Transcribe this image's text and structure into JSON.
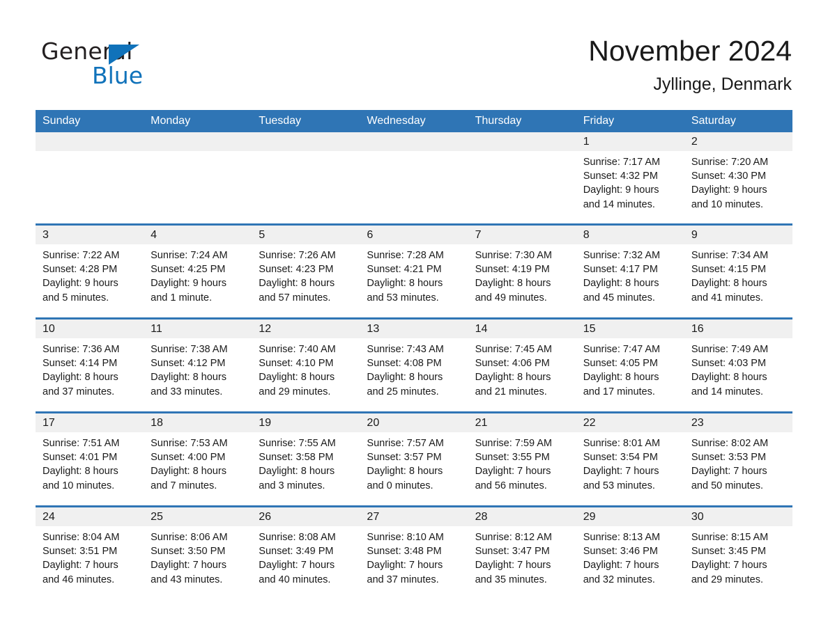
{
  "brand": {
    "name_part1": "General",
    "name_part2": "Blue",
    "accent_color": "#1072ba",
    "triangle_icon": "triangle-icon"
  },
  "header": {
    "title": "November 2024",
    "location": "Jyllinge, Denmark"
  },
  "theme": {
    "header_blue": "#2f75b5",
    "daynum_band": "#f0f0f0",
    "text": "#1a1a1a"
  },
  "weekdays": [
    "Sunday",
    "Monday",
    "Tuesday",
    "Wednesday",
    "Thursday",
    "Friday",
    "Saturday"
  ],
  "weeks": [
    [
      {
        "day": "",
        "lines": []
      },
      {
        "day": "",
        "lines": []
      },
      {
        "day": "",
        "lines": []
      },
      {
        "day": "",
        "lines": []
      },
      {
        "day": "",
        "lines": []
      },
      {
        "day": "1",
        "lines": [
          "Sunrise: 7:17 AM",
          "Sunset: 4:32 PM",
          "Daylight: 9 hours",
          "and 14 minutes."
        ]
      },
      {
        "day": "2",
        "lines": [
          "Sunrise: 7:20 AM",
          "Sunset: 4:30 PM",
          "Daylight: 9 hours",
          "and 10 minutes."
        ]
      }
    ],
    [
      {
        "day": "3",
        "lines": [
          "Sunrise: 7:22 AM",
          "Sunset: 4:28 PM",
          "Daylight: 9 hours",
          "and 5 minutes."
        ]
      },
      {
        "day": "4",
        "lines": [
          "Sunrise: 7:24 AM",
          "Sunset: 4:25 PM",
          "Daylight: 9 hours",
          "and 1 minute."
        ]
      },
      {
        "day": "5",
        "lines": [
          "Sunrise: 7:26 AM",
          "Sunset: 4:23 PM",
          "Daylight: 8 hours",
          "and 57 minutes."
        ]
      },
      {
        "day": "6",
        "lines": [
          "Sunrise: 7:28 AM",
          "Sunset: 4:21 PM",
          "Daylight: 8 hours",
          "and 53 minutes."
        ]
      },
      {
        "day": "7",
        "lines": [
          "Sunrise: 7:30 AM",
          "Sunset: 4:19 PM",
          "Daylight: 8 hours",
          "and 49 minutes."
        ]
      },
      {
        "day": "8",
        "lines": [
          "Sunrise: 7:32 AM",
          "Sunset: 4:17 PM",
          "Daylight: 8 hours",
          "and 45 minutes."
        ]
      },
      {
        "day": "9",
        "lines": [
          "Sunrise: 7:34 AM",
          "Sunset: 4:15 PM",
          "Daylight: 8 hours",
          "and 41 minutes."
        ]
      }
    ],
    [
      {
        "day": "10",
        "lines": [
          "Sunrise: 7:36 AM",
          "Sunset: 4:14 PM",
          "Daylight: 8 hours",
          "and 37 minutes."
        ]
      },
      {
        "day": "11",
        "lines": [
          "Sunrise: 7:38 AM",
          "Sunset: 4:12 PM",
          "Daylight: 8 hours",
          "and 33 minutes."
        ]
      },
      {
        "day": "12",
        "lines": [
          "Sunrise: 7:40 AM",
          "Sunset: 4:10 PM",
          "Daylight: 8 hours",
          "and 29 minutes."
        ]
      },
      {
        "day": "13",
        "lines": [
          "Sunrise: 7:43 AM",
          "Sunset: 4:08 PM",
          "Daylight: 8 hours",
          "and 25 minutes."
        ]
      },
      {
        "day": "14",
        "lines": [
          "Sunrise: 7:45 AM",
          "Sunset: 4:06 PM",
          "Daylight: 8 hours",
          "and 21 minutes."
        ]
      },
      {
        "day": "15",
        "lines": [
          "Sunrise: 7:47 AM",
          "Sunset: 4:05 PM",
          "Daylight: 8 hours",
          "and 17 minutes."
        ]
      },
      {
        "day": "16",
        "lines": [
          "Sunrise: 7:49 AM",
          "Sunset: 4:03 PM",
          "Daylight: 8 hours",
          "and 14 minutes."
        ]
      }
    ],
    [
      {
        "day": "17",
        "lines": [
          "Sunrise: 7:51 AM",
          "Sunset: 4:01 PM",
          "Daylight: 8 hours",
          "and 10 minutes."
        ]
      },
      {
        "day": "18",
        "lines": [
          "Sunrise: 7:53 AM",
          "Sunset: 4:00 PM",
          "Daylight: 8 hours",
          "and 7 minutes."
        ]
      },
      {
        "day": "19",
        "lines": [
          "Sunrise: 7:55 AM",
          "Sunset: 3:58 PM",
          "Daylight: 8 hours",
          "and 3 minutes."
        ]
      },
      {
        "day": "20",
        "lines": [
          "Sunrise: 7:57 AM",
          "Sunset: 3:57 PM",
          "Daylight: 8 hours",
          "and 0 minutes."
        ]
      },
      {
        "day": "21",
        "lines": [
          "Sunrise: 7:59 AM",
          "Sunset: 3:55 PM",
          "Daylight: 7 hours",
          "and 56 minutes."
        ]
      },
      {
        "day": "22",
        "lines": [
          "Sunrise: 8:01 AM",
          "Sunset: 3:54 PM",
          "Daylight: 7 hours",
          "and 53 minutes."
        ]
      },
      {
        "day": "23",
        "lines": [
          "Sunrise: 8:02 AM",
          "Sunset: 3:53 PM",
          "Daylight: 7 hours",
          "and 50 minutes."
        ]
      }
    ],
    [
      {
        "day": "24",
        "lines": [
          "Sunrise: 8:04 AM",
          "Sunset: 3:51 PM",
          "Daylight: 7 hours",
          "and 46 minutes."
        ]
      },
      {
        "day": "25",
        "lines": [
          "Sunrise: 8:06 AM",
          "Sunset: 3:50 PM",
          "Daylight: 7 hours",
          "and 43 minutes."
        ]
      },
      {
        "day": "26",
        "lines": [
          "Sunrise: 8:08 AM",
          "Sunset: 3:49 PM",
          "Daylight: 7 hours",
          "and 40 minutes."
        ]
      },
      {
        "day": "27",
        "lines": [
          "Sunrise: 8:10 AM",
          "Sunset: 3:48 PM",
          "Daylight: 7 hours",
          "and 37 minutes."
        ]
      },
      {
        "day": "28",
        "lines": [
          "Sunrise: 8:12 AM",
          "Sunset: 3:47 PM",
          "Daylight: 7 hours",
          "and 35 minutes."
        ]
      },
      {
        "day": "29",
        "lines": [
          "Sunrise: 8:13 AM",
          "Sunset: 3:46 PM",
          "Daylight: 7 hours",
          "and 32 minutes."
        ]
      },
      {
        "day": "30",
        "lines": [
          "Sunrise: 8:15 AM",
          "Sunset: 3:45 PM",
          "Daylight: 7 hours",
          "and 29 minutes."
        ]
      }
    ]
  ]
}
